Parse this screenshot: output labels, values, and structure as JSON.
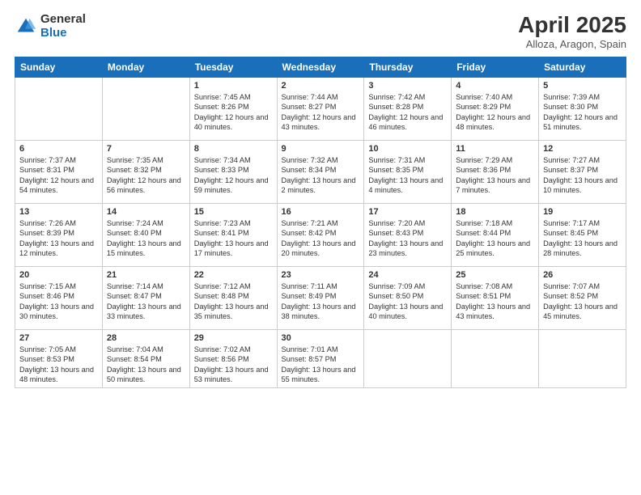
{
  "logo": {
    "general": "General",
    "blue": "Blue"
  },
  "header": {
    "title": "April 2025",
    "subtitle": "Alloza, Aragon, Spain"
  },
  "weekdays": [
    "Sunday",
    "Monday",
    "Tuesday",
    "Wednesday",
    "Thursday",
    "Friday",
    "Saturday"
  ],
  "weeks": [
    [
      {
        "day": "",
        "info": ""
      },
      {
        "day": "",
        "info": ""
      },
      {
        "day": "1",
        "info": "Sunrise: 7:45 AM\nSunset: 8:26 PM\nDaylight: 12 hours and 40 minutes."
      },
      {
        "day": "2",
        "info": "Sunrise: 7:44 AM\nSunset: 8:27 PM\nDaylight: 12 hours and 43 minutes."
      },
      {
        "day": "3",
        "info": "Sunrise: 7:42 AM\nSunset: 8:28 PM\nDaylight: 12 hours and 46 minutes."
      },
      {
        "day": "4",
        "info": "Sunrise: 7:40 AM\nSunset: 8:29 PM\nDaylight: 12 hours and 48 minutes."
      },
      {
        "day": "5",
        "info": "Sunrise: 7:39 AM\nSunset: 8:30 PM\nDaylight: 12 hours and 51 minutes."
      }
    ],
    [
      {
        "day": "6",
        "info": "Sunrise: 7:37 AM\nSunset: 8:31 PM\nDaylight: 12 hours and 54 minutes."
      },
      {
        "day": "7",
        "info": "Sunrise: 7:35 AM\nSunset: 8:32 PM\nDaylight: 12 hours and 56 minutes."
      },
      {
        "day": "8",
        "info": "Sunrise: 7:34 AM\nSunset: 8:33 PM\nDaylight: 12 hours and 59 minutes."
      },
      {
        "day": "9",
        "info": "Sunrise: 7:32 AM\nSunset: 8:34 PM\nDaylight: 13 hours and 2 minutes."
      },
      {
        "day": "10",
        "info": "Sunrise: 7:31 AM\nSunset: 8:35 PM\nDaylight: 13 hours and 4 minutes."
      },
      {
        "day": "11",
        "info": "Sunrise: 7:29 AM\nSunset: 8:36 PM\nDaylight: 13 hours and 7 minutes."
      },
      {
        "day": "12",
        "info": "Sunrise: 7:27 AM\nSunset: 8:37 PM\nDaylight: 13 hours and 10 minutes."
      }
    ],
    [
      {
        "day": "13",
        "info": "Sunrise: 7:26 AM\nSunset: 8:39 PM\nDaylight: 13 hours and 12 minutes."
      },
      {
        "day": "14",
        "info": "Sunrise: 7:24 AM\nSunset: 8:40 PM\nDaylight: 13 hours and 15 minutes."
      },
      {
        "day": "15",
        "info": "Sunrise: 7:23 AM\nSunset: 8:41 PM\nDaylight: 13 hours and 17 minutes."
      },
      {
        "day": "16",
        "info": "Sunrise: 7:21 AM\nSunset: 8:42 PM\nDaylight: 13 hours and 20 minutes."
      },
      {
        "day": "17",
        "info": "Sunrise: 7:20 AM\nSunset: 8:43 PM\nDaylight: 13 hours and 23 minutes."
      },
      {
        "day": "18",
        "info": "Sunrise: 7:18 AM\nSunset: 8:44 PM\nDaylight: 13 hours and 25 minutes."
      },
      {
        "day": "19",
        "info": "Sunrise: 7:17 AM\nSunset: 8:45 PM\nDaylight: 13 hours and 28 minutes."
      }
    ],
    [
      {
        "day": "20",
        "info": "Sunrise: 7:15 AM\nSunset: 8:46 PM\nDaylight: 13 hours and 30 minutes."
      },
      {
        "day": "21",
        "info": "Sunrise: 7:14 AM\nSunset: 8:47 PM\nDaylight: 13 hours and 33 minutes."
      },
      {
        "day": "22",
        "info": "Sunrise: 7:12 AM\nSunset: 8:48 PM\nDaylight: 13 hours and 35 minutes."
      },
      {
        "day": "23",
        "info": "Sunrise: 7:11 AM\nSunset: 8:49 PM\nDaylight: 13 hours and 38 minutes."
      },
      {
        "day": "24",
        "info": "Sunrise: 7:09 AM\nSunset: 8:50 PM\nDaylight: 13 hours and 40 minutes."
      },
      {
        "day": "25",
        "info": "Sunrise: 7:08 AM\nSunset: 8:51 PM\nDaylight: 13 hours and 43 minutes."
      },
      {
        "day": "26",
        "info": "Sunrise: 7:07 AM\nSunset: 8:52 PM\nDaylight: 13 hours and 45 minutes."
      }
    ],
    [
      {
        "day": "27",
        "info": "Sunrise: 7:05 AM\nSunset: 8:53 PM\nDaylight: 13 hours and 48 minutes."
      },
      {
        "day": "28",
        "info": "Sunrise: 7:04 AM\nSunset: 8:54 PM\nDaylight: 13 hours and 50 minutes."
      },
      {
        "day": "29",
        "info": "Sunrise: 7:02 AM\nSunset: 8:56 PM\nDaylight: 13 hours and 53 minutes."
      },
      {
        "day": "30",
        "info": "Sunrise: 7:01 AM\nSunset: 8:57 PM\nDaylight: 13 hours and 55 minutes."
      },
      {
        "day": "",
        "info": ""
      },
      {
        "day": "",
        "info": ""
      },
      {
        "day": "",
        "info": ""
      }
    ]
  ]
}
